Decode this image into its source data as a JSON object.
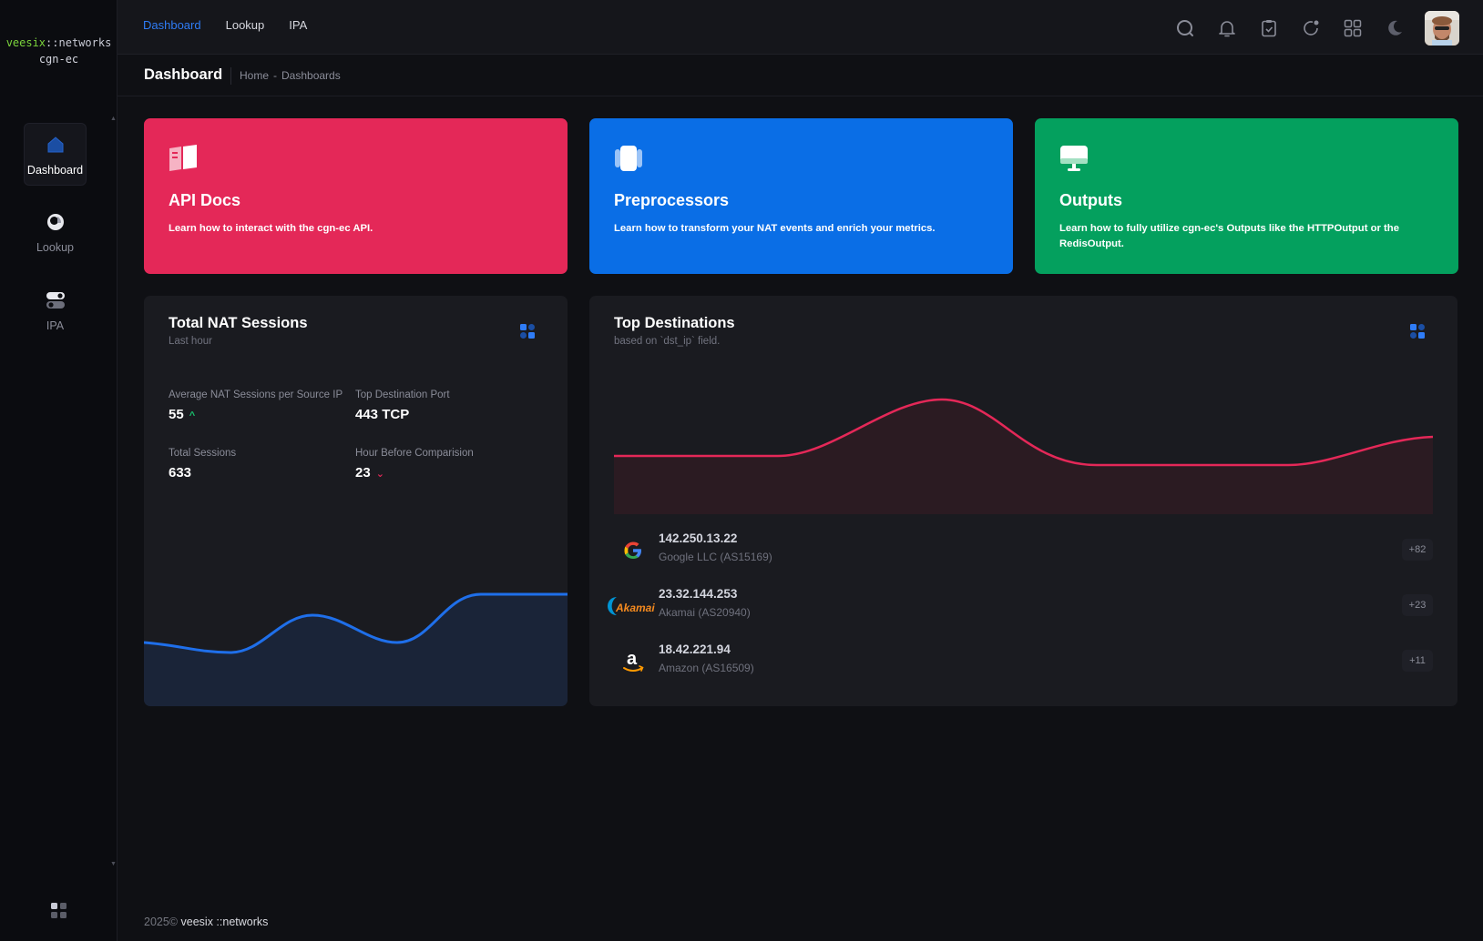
{
  "brand": {
    "prefix": "veesix",
    "suffix": "::networks",
    "app": "cgn-ec"
  },
  "sidebar": {
    "items": [
      {
        "label": "Dashboard",
        "icon": "home-icon",
        "active": true
      },
      {
        "label": "Lookup",
        "icon": "lookup-icon",
        "active": false
      },
      {
        "label": "IPA",
        "icon": "toggle-icon",
        "active": false
      }
    ]
  },
  "topbar": {
    "menu": [
      "Dashboard",
      "Lookup",
      "IPA"
    ],
    "icons": [
      "search-icon",
      "bell-icon",
      "clipboard-icon",
      "refresh-icon",
      "apps-grid-icon",
      "theme-moon-icon"
    ]
  },
  "toolbar": {
    "title": "Dashboard",
    "breadcrumb": [
      "Home",
      "Dashboards"
    ]
  },
  "banners": [
    {
      "title": "API Docs",
      "text": "Learn how to interact with the cgn-ec API.",
      "icon": "book-icon",
      "color": "#e42858"
    },
    {
      "title": "Preprocessors",
      "text": "Learn how to transform your NAT events and enrich your metrics.",
      "icon": "layers-icon",
      "color": "#0a6ee6"
    },
    {
      "title": "Outputs",
      "text": "Learn how to fully utilize cgn-ec's Outputs like the HTTPOutput or the RedisOutput.",
      "icon": "monitor-icon",
      "color": "#04a05e"
    }
  ],
  "nat": {
    "title": "Total NAT Sessions",
    "subtitle": "Last hour",
    "stats": [
      {
        "label": "Average NAT Sessions per Source IP",
        "value": "55",
        "trend": "up"
      },
      {
        "label": "Top Destination Port",
        "value": "443 TCP"
      },
      {
        "label": "Total Sessions",
        "value": "633"
      },
      {
        "label": "Hour Before Comparision",
        "value": "23",
        "trend": "down"
      }
    ]
  },
  "destinations": {
    "title": "Top Destinations",
    "subtitle": "based on `dst_ip` field.",
    "rows": [
      {
        "ip": "142.250.13.22",
        "org": "Google LLC (AS15169)",
        "count": "+82",
        "logo": "google-logo"
      },
      {
        "ip": "23.32.144.253",
        "org": "Akamai (AS20940)",
        "count": "+23",
        "logo": "akamai-logo",
        "logo_text": "Akamai"
      },
      {
        "ip": "18.42.221.94",
        "org": "Amazon (AS16509)",
        "count": "+11",
        "logo": "amazon-logo",
        "logo_text": "a"
      }
    ]
  },
  "footer": {
    "year": "2025©",
    "brand": "veesix ::networks"
  },
  "colors": {
    "accent": "#2f7cf6",
    "red": "#e42858",
    "blue": "#0a6ee6",
    "green": "#04a05e"
  }
}
